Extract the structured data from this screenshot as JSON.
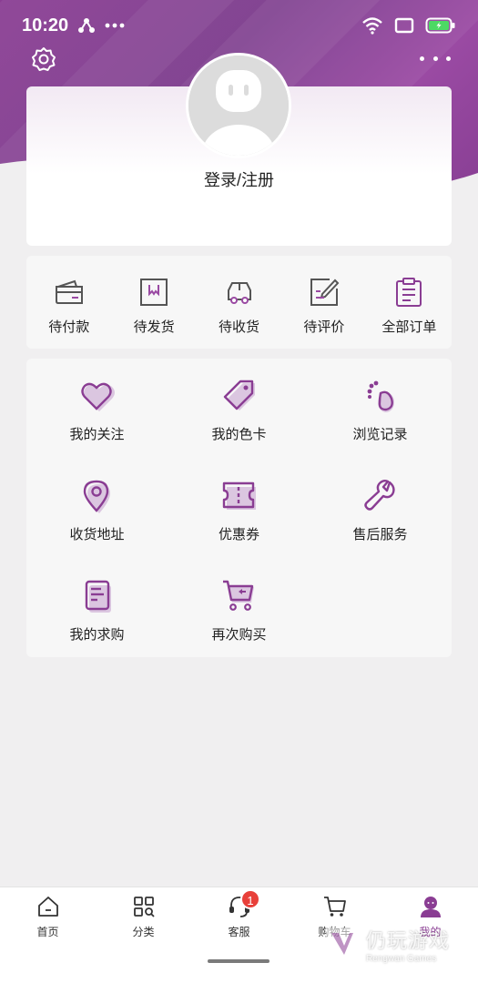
{
  "status_bar": {
    "time": "10:20"
  },
  "profile": {
    "login_label": "登录/注册"
  },
  "orders": [
    {
      "label": "待付款",
      "icon": "wallet-icon"
    },
    {
      "label": "待发货",
      "icon": "package-icon"
    },
    {
      "label": "待收货",
      "icon": "truck-icon"
    },
    {
      "label": "待评价",
      "icon": "review-edit-icon"
    },
    {
      "label": "全部订单",
      "icon": "clipboard-icon"
    }
  ],
  "services": [
    {
      "label": "我的关注",
      "icon": "heart-icon"
    },
    {
      "label": "我的色卡",
      "icon": "tag-icon"
    },
    {
      "label": "浏览记录",
      "icon": "footprint-icon"
    },
    {
      "label": "收货地址",
      "icon": "location-pin-icon"
    },
    {
      "label": "优惠券",
      "icon": "coupon-icon"
    },
    {
      "label": "售后服务",
      "icon": "wrench-icon"
    },
    {
      "label": "我的求购",
      "icon": "document-icon"
    },
    {
      "label": "再次购买",
      "icon": "cart-icon"
    }
  ],
  "tabbar": {
    "items": [
      {
        "label": "首页",
        "icon": "home-icon"
      },
      {
        "label": "分类",
        "icon": "category-icon"
      },
      {
        "label": "客服",
        "icon": "headset-icon",
        "badge": "1"
      },
      {
        "label": "购物车",
        "icon": "cart-icon"
      },
      {
        "label": "我的",
        "icon": "user-icon"
      }
    ]
  },
  "watermark": {
    "main": "仍玩游戏",
    "sub": "Rengwan Games"
  },
  "colors": {
    "brand": "#8a3d93",
    "badge": "#e8403a",
    "background": "#f0eff0"
  }
}
